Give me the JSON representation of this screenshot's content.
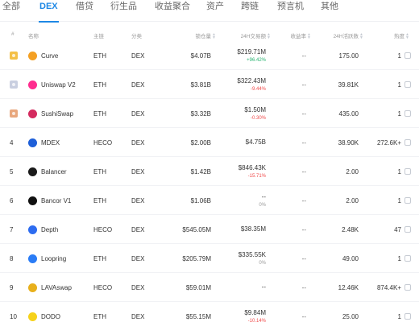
{
  "tabs": [
    {
      "label": "全部",
      "active": false
    },
    {
      "label": "DEX",
      "active": true
    },
    {
      "label": "借贷",
      "active": false
    },
    {
      "label": "衍生品",
      "active": false
    },
    {
      "label": "收益聚合",
      "active": false
    },
    {
      "label": "资产",
      "active": false
    },
    {
      "label": "跨链",
      "active": false
    },
    {
      "label": "预言机",
      "active": false
    },
    {
      "label": "其他",
      "active": false
    }
  ],
  "columns": {
    "rank": "#",
    "name": "名称",
    "chain": "主链",
    "category": "分类",
    "tvl": "锁仓量",
    "volume": "24H交易额",
    "mcap": "收益率",
    "users": "24H活跃数",
    "heat": "热度"
  },
  "rows": [
    {
      "rank": "",
      "medal": "gold",
      "name": "Curve",
      "logo_color": "#f4a023",
      "chain": "ETH",
      "category": "DEX",
      "tvl": "$4.07B",
      "volume": "$219.71M",
      "change": "+96.42%",
      "change_dir": "up",
      "mcap": "--",
      "users": "175.00",
      "heat": "1"
    },
    {
      "rank": "",
      "medal": "silver",
      "name": "Uniswap V2",
      "logo_color": "#ff2d8f",
      "chain": "ETH",
      "category": "DEX",
      "tvl": "$3.81B",
      "volume": "$322.43M",
      "change": "-9.44%",
      "change_dir": "down",
      "mcap": "--",
      "users": "39.81K",
      "heat": "1"
    },
    {
      "rank": "",
      "medal": "bronze",
      "name": "SushiSwap",
      "logo_color": "#d42b5f",
      "chain": "ETH",
      "category": "DEX",
      "tvl": "$3.32B",
      "volume": "$1.50M",
      "change": "-0.30%",
      "change_dir": "down",
      "mcap": "--",
      "users": "435.00",
      "heat": "1"
    },
    {
      "rank": "4",
      "medal": "",
      "name": "MDEX",
      "logo_color": "#1e5fd8",
      "chain": "HECO",
      "category": "DEX",
      "tvl": "$2.00B",
      "volume": "$4.75B",
      "change": "",
      "change_dir": "",
      "mcap": "--",
      "users": "38.90K",
      "heat": "272.6K+"
    },
    {
      "rank": "5",
      "medal": "",
      "name": "Balancer",
      "logo_color": "#1a1a1a",
      "chain": "ETH",
      "category": "DEX",
      "tvl": "$1.42B",
      "volume": "$846.43K",
      "change": "-15.71%",
      "change_dir": "down",
      "mcap": "--",
      "users": "2.00",
      "heat": "1"
    },
    {
      "rank": "6",
      "medal": "",
      "name": "Bancor V1",
      "logo_color": "#111111",
      "chain": "ETH",
      "category": "DEX",
      "tvl": "$1.06B",
      "volume": "--",
      "change": "0%",
      "change_dir": "zero",
      "mcap": "--",
      "users": "2.00",
      "heat": "1"
    },
    {
      "rank": "7",
      "medal": "",
      "name": "Depth",
      "logo_color": "#2d6cf0",
      "chain": "HECO",
      "category": "DEX",
      "tvl": "$545.05M",
      "volume": "$38.35M",
      "change": "",
      "change_dir": "",
      "mcap": "--",
      "users": "2.48K",
      "heat": "47"
    },
    {
      "rank": "8",
      "medal": "",
      "name": "Loopring",
      "logo_color": "#2a7cf6",
      "chain": "ETH",
      "category": "DEX",
      "tvl": "$205.79M",
      "volume": "$335.55K",
      "change": "0%",
      "change_dir": "zero",
      "mcap": "--",
      "users": "49.00",
      "heat": "1"
    },
    {
      "rank": "9",
      "medal": "",
      "name": "LAVAswap",
      "logo_color": "#e8b01c",
      "chain": "HECO",
      "category": "DEX",
      "tvl": "$59.01M",
      "volume": "--",
      "change": "",
      "change_dir": "",
      "mcap": "--",
      "users": "12.46K",
      "heat": "874.4K+"
    },
    {
      "rank": "10",
      "medal": "",
      "name": "DODO",
      "logo_color": "#f6d21b",
      "chain": "ETH",
      "category": "DEX",
      "tvl": "$55.15M",
      "volume": "$9.84M",
      "change": "-10.14%",
      "change_dir": "down",
      "mcap": "--",
      "users": "25.00",
      "heat": "1"
    }
  ]
}
